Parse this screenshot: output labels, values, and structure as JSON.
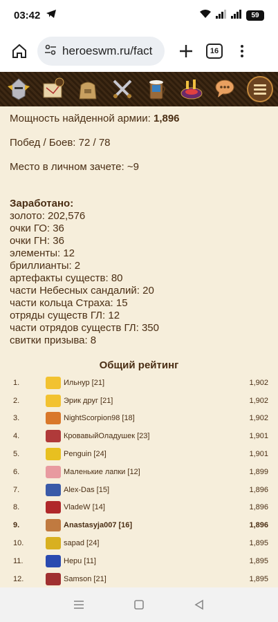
{
  "status_bar": {
    "time": "03:42",
    "battery": "59"
  },
  "browser": {
    "url": "heroeswm.ru/fact",
    "tab_count": "16"
  },
  "game_nav": {
    "icons": [
      "knight-helmet-icon",
      "map-scroll-icon",
      "bag-icon",
      "crossed-swords-icon",
      "tavern-icon",
      "roulette-icon",
      "chat-icon"
    ]
  },
  "stats": {
    "power_label": "Мощность найденной армии: ",
    "power_value": "1,896",
    "wins": "Побед / Боев: 72 / 78",
    "place": "Место в личном зачете: ~9"
  },
  "earned": {
    "title": "Заработано:",
    "items": [
      "золото: 202,576",
      "очки ГО: 36",
      "очки ГН: 36",
      "элементы: 12",
      "бриллианты: 2",
      "артефакты существ: 80",
      "части Небесных сандалий: 20",
      "части кольца Страха: 15",
      "отряды существ ГЛ: 12",
      "части отрядов существ ГЛ: 350",
      "свитки призыва: 8"
    ]
  },
  "rating": {
    "title": "Общий рейтинг",
    "rows": [
      {
        "rank": "1.",
        "name": "Ильнур [21]",
        "score": "1,902",
        "avatar": "#f2c230"
      },
      {
        "rank": "2.",
        "name": "Эрик друг [21]",
        "score": "1,902",
        "avatar": "#f2c230"
      },
      {
        "rank": "3.",
        "name": "NightScorpion98 [18]",
        "score": "1,902",
        "avatar": "#d9782a"
      },
      {
        "rank": "4.",
        "name": "КровавыйОладушек [23]",
        "score": "1,901",
        "avatar": "#b03a3a"
      },
      {
        "rank": "5.",
        "name": "Penguin [24]",
        "score": "1,901",
        "avatar": "#e8c020"
      },
      {
        "rank": "6.",
        "name": "Маленькие лапки [12]",
        "score": "1,899",
        "avatar": "#e89aa0"
      },
      {
        "rank": "7.",
        "name": "Alex-Das [15]",
        "score": "1,896",
        "avatar": "#3a5aa8"
      },
      {
        "rank": "8.",
        "name": "VladeW [14]",
        "score": "1,896",
        "avatar": "#b0282a"
      },
      {
        "rank": "9.",
        "name": "Anastasyja007 [16]",
        "score": "1,896",
        "avatar": "#c07a40",
        "current": true
      },
      {
        "rank": "10.",
        "name": "sapad [24]",
        "score": "1,895",
        "avatar": "#d8b020"
      },
      {
        "rank": "11.",
        "name": "Hepu [11]",
        "score": "1,895",
        "avatar": "#2a4ab0"
      },
      {
        "rank": "12.",
        "name": "Samson [21]",
        "score": "1,895",
        "avatar": "#a03030"
      }
    ]
  }
}
